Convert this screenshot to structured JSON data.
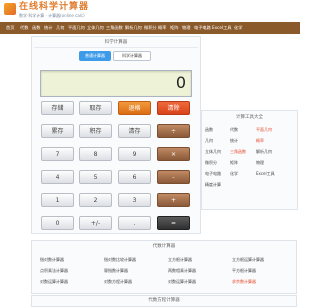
{
  "header": {
    "logo_title": "在线科学计算器",
    "logo_subtitle": "数学·科学计算 · 计算器(online calc)"
  },
  "nav": [
    "首页",
    "代数",
    "函数",
    "统计",
    "几何",
    "平面几何",
    "立体几何",
    "三角函数",
    "解析几何",
    "微积分",
    "概率",
    "矩阵",
    "物理",
    "电子电路",
    "Excel工具",
    "化学"
  ],
  "calculator": {
    "title": "科学计算器",
    "tabs": [
      "普通计算器",
      "科学计算器"
    ],
    "display_value": "0",
    "keys": [
      [
        "存储",
        "取存",
        "退格",
        "清除"
      ],
      [
        "累存",
        "积存",
        "清存",
        "÷"
      ],
      [
        "7",
        "8",
        "9",
        "×"
      ],
      [
        "4",
        "5",
        "6",
        "-"
      ],
      [
        "1",
        "2",
        "3",
        "+"
      ],
      [
        "0",
        "+/-",
        "."
      ]
    ],
    "equals_label": "="
  },
  "side_panel": {
    "title": "计算工具大全",
    "links": [
      [
        "函数",
        "代数",
        "平面几何"
      ],
      [
        "几何",
        "统计",
        "概率"
      ],
      [
        "立体几何",
        "三角函数",
        "解析几何"
      ],
      [
        "微积分",
        "矩阵",
        "物理"
      ],
      [
        "电子电路",
        "化学",
        "Excel工具"
      ],
      [
        "精度计算",
        "",
        ""
      ]
    ]
  },
  "calc_box": {
    "title": "代数计算器",
    "links": [
      [
        "指对数计算器",
        "指对数比较计算器",
        "立方根计算器",
        "立方根运算计算器"
      ],
      [
        "点积乘法计算器",
        "幂指数计算器",
        "两数相乘计算器",
        "平方根计算器"
      ],
      [
        "对数运算计算器",
        "对数方程计算器",
        "对数运算计算器",
        "求余数计算器"
      ]
    ]
  },
  "bottom_box": {
    "title": "代数方程计算器"
  }
}
